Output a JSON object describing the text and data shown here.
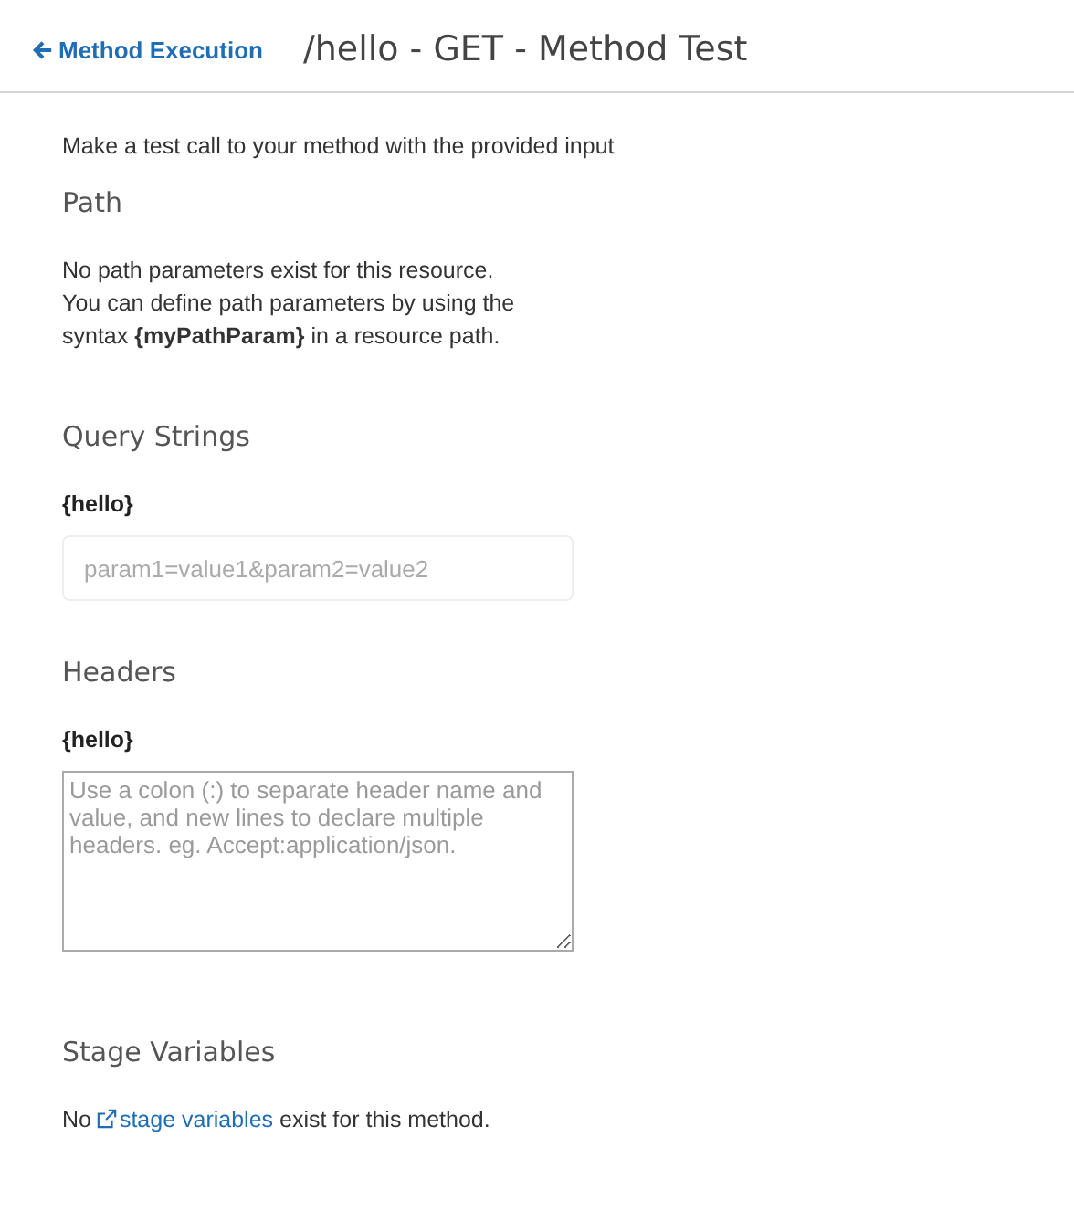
{
  "header": {
    "back_link": "Method Execution",
    "title": "/hello - GET - Method Test"
  },
  "intro": "Make a test call to your method with the provided input",
  "path": {
    "heading": "Path",
    "lines": [
      "No path parameters exist for this resource.",
      "You can define path parameters by using the",
      "syntax **{myPathParam}** in a resource path."
    ]
  },
  "query_strings": {
    "heading": "Query Strings",
    "label": "{hello}",
    "placeholder": "param1=value1&param2=value2"
  },
  "headers": {
    "heading": "Headers",
    "label": "{hello}",
    "placeholder": "Use a colon (:) to separate header name and value, and new lines to declare multiple headers. eg. Accept:application/json."
  },
  "stage_variables": {
    "heading": "Stage Variables",
    "before": "No ",
    "link": "stage variables",
    "after": " exist for this method."
  }
}
